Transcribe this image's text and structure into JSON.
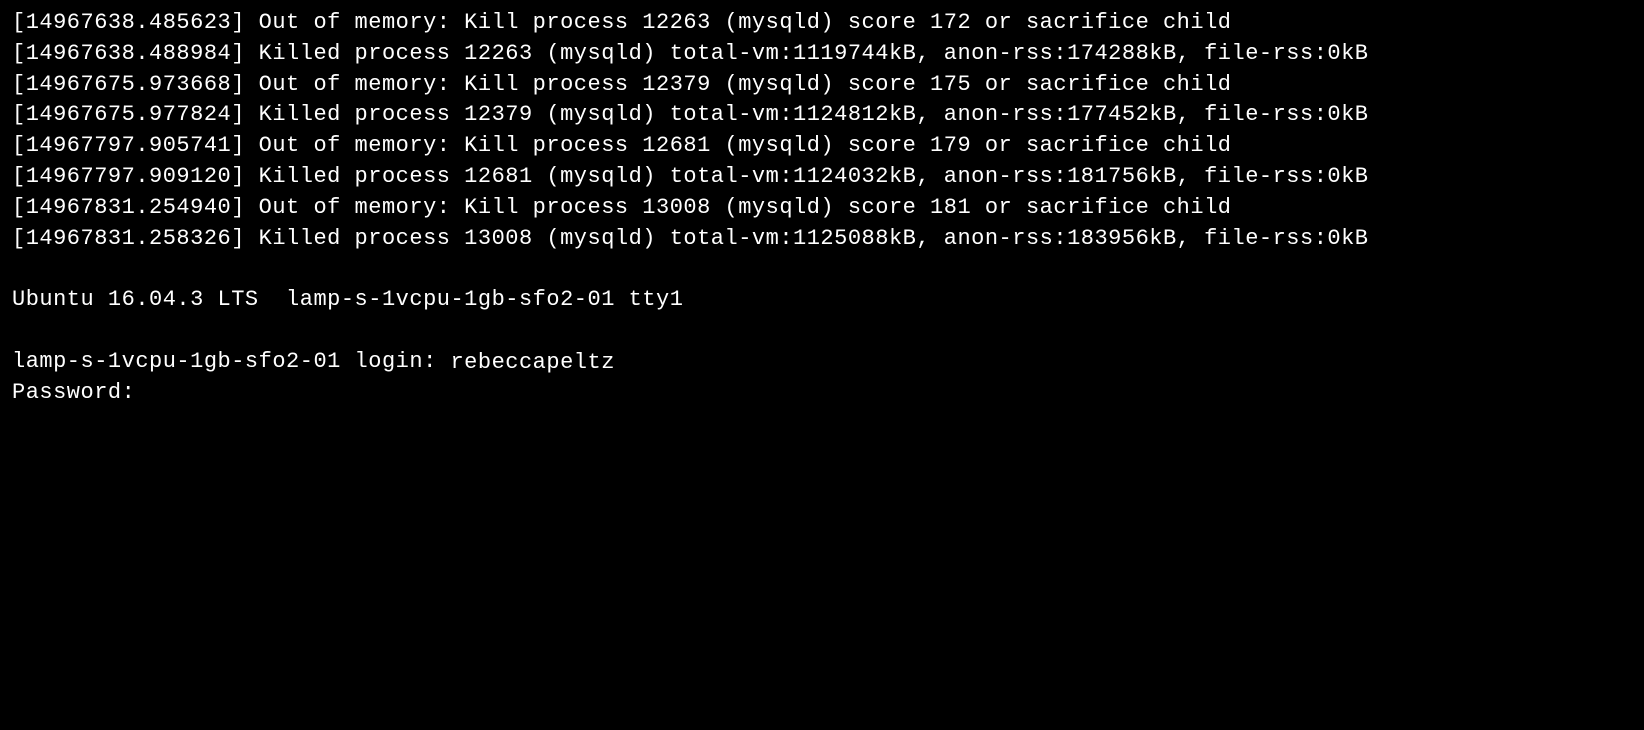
{
  "kernel_log": [
    "[14967638.485623] Out of memory: Kill process 12263 (mysqld) score 172 or sacrifice child",
    "[14967638.488984] Killed process 12263 (mysqld) total-vm:1119744kB, anon-rss:174288kB, file-rss:0kB",
    "[14967675.973668] Out of memory: Kill process 12379 (mysqld) score 175 or sacrifice child",
    "[14967675.977824] Killed process 12379 (mysqld) total-vm:1124812kB, anon-rss:177452kB, file-rss:0kB",
    "[14967797.905741] Out of memory: Kill process 12681 (mysqld) score 179 or sacrifice child",
    "[14967797.909120] Killed process 12681 (mysqld) total-vm:1124032kB, anon-rss:181756kB, file-rss:0kB",
    "[14967831.254940] Out of memory: Kill process 13008 (mysqld) score 181 or sacrifice child",
    "[14967831.258326] Killed process 13008 (mysqld) total-vm:1125088kB, anon-rss:183956kB, file-rss:0kB"
  ],
  "banner": "Ubuntu 16.04.3 LTS  lamp-s-1vcpu-1gb-sfo2-01 tty1",
  "login": {
    "prompt": "lamp-s-1vcpu-1gb-sfo2-01 login: ",
    "username": "rebeccapeltz",
    "password_label": "Password: ",
    "password_value": ""
  }
}
